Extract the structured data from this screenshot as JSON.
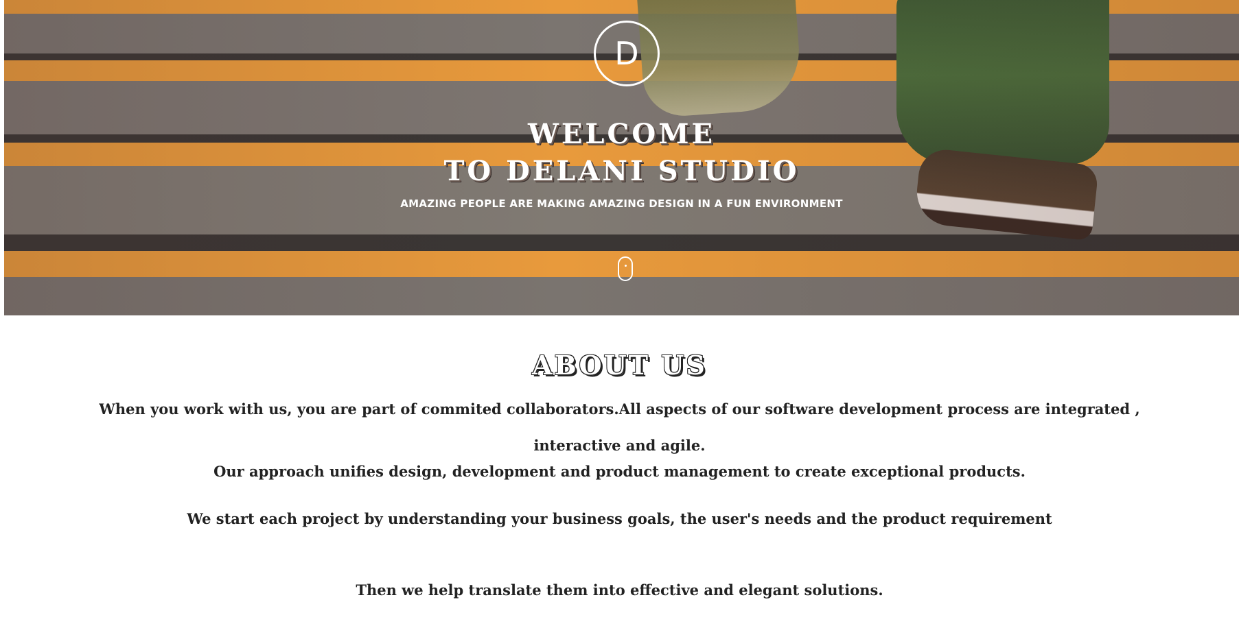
{
  "hero": {
    "logo_letter": "D",
    "title_line1": "WELCOME",
    "title_line2": "TO DELANI STUDIO",
    "subtitle": "AMAZING PEOPLE ARE MAKING AMAZING DESIGN IN A FUN ENVIRONMENT",
    "scroll_icon": "mouse-scroll-icon",
    "stripe_colors": {
      "orange": "#e89a3c",
      "grey": "#7b7570",
      "dark": "#3a3634"
    }
  },
  "about": {
    "heading": "ABOUT US",
    "paragraph1": "When you work with us, you are part of commited collaborators.All aspects of our software development process are integrated , interactive and agile.",
    "paragraph2": "Our approach unifies design, development and product management to create exceptional products.",
    "paragraph3": "We start each project by understanding your business goals, the user's needs and the product requirement",
    "paragraph4": "Then we help translate them into effective and elegant solutions."
  }
}
